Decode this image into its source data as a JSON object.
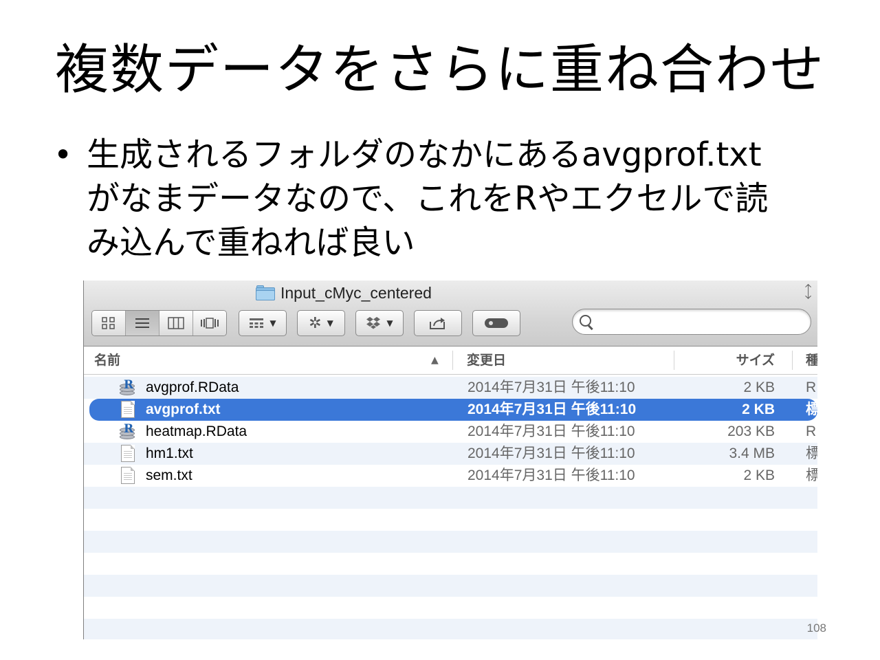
{
  "slide": {
    "title": "複数データをさらに重ね合わせ",
    "bullet_lines": [
      "生成されるフォルダのなかにあるavgprof.txt",
      "がなまデータなので、これをRやエクセルで読",
      "み込んで重ねれば良い"
    ],
    "page_number": "108"
  },
  "finder": {
    "window_title": "Input_cMyc_centered",
    "toolbar": {
      "view_modes": [
        "icon-view",
        "list-view",
        "column-view",
        "cover-flow-view"
      ],
      "active_view": "list-view"
    },
    "search": {
      "value": "",
      "placeholder": ""
    },
    "columns": {
      "name": "名前",
      "sort_indicator": "▲",
      "date": "変更日",
      "size": "サイズ",
      "kind": "種"
    },
    "files": [
      {
        "name": "avgprof.RData",
        "date": "2014年7月31日 午後11:10",
        "size": "2 KB",
        "kind": "R",
        "icon": "rdata-icon",
        "selected": false
      },
      {
        "name": "avgprof.txt",
        "date": "2014年7月31日 午後11:10",
        "size": "2 KB",
        "kind": "標",
        "icon": "text-file-icon",
        "selected": true
      },
      {
        "name": "heatmap.RData",
        "date": "2014年7月31日 午後11:10",
        "size": "203 KB",
        "kind": "R",
        "icon": "rdata-icon",
        "selected": false
      },
      {
        "name": "hm1.txt",
        "date": "2014年7月31日 午後11:10",
        "size": "3.4 MB",
        "kind": "標",
        "icon": "text-file-icon",
        "selected": false
      },
      {
        "name": "sem.txt",
        "date": "2014年7月31日 午後11:10",
        "size": "2 KB",
        "kind": "標",
        "icon": "text-file-icon",
        "selected": false
      }
    ],
    "selection_color": "#3b78d8",
    "stripe_color": "#eef3fa"
  }
}
